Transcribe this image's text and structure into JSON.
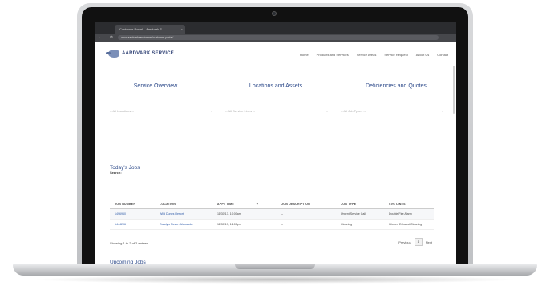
{
  "browser": {
    "tab_title": "Customer Portal – Aardvark S…",
    "tab_close": "×",
    "url": "www.aardvarkservice.net/customer-portal/",
    "nav_back": "←",
    "nav_forward": "→",
    "nav_reload": "⟳",
    "menu": "⋮"
  },
  "site": {
    "logo_text": "AARDVARK SERVICE",
    "nav": [
      "Home",
      "Products and Services",
      "Service Areas",
      "Service Request",
      "About Us",
      "Contact"
    ]
  },
  "tabs": [
    "Service Overview",
    "Locations and Assets",
    "Deficiencies and Quotes"
  ],
  "filters": [
    "-- All Locations --",
    "-- All Service Lines --",
    "-- All Job Types --"
  ],
  "todays_jobs": {
    "title": "Today's Jobs",
    "search_label": "Search:",
    "columns": [
      "JOB NUMBER",
      "LOCATION",
      "APPT TIME",
      "JOB DESCRIPTION",
      "JOB TYPE",
      "SVC LINES"
    ],
    "sort_indicator": "▼",
    "rows": [
      [
        "1496960",
        "Wild Dunes Resort",
        "11/30/17, 10:00am",
        "–",
        "Urgent Service Call",
        "Double Fire Alarm"
      ],
      [
        "1444206",
        "Randy's Pizza - Alexander",
        "11/30/17, 12:00pm",
        "–",
        "Cleaning",
        "Kitchen Exhaust Cleaning"
      ]
    ],
    "showing": "Showing 1 to 2 of 2 entries",
    "pager": {
      "previous": "Previous",
      "current": "1",
      "next": "Next"
    }
  },
  "upcoming_jobs": {
    "title": "Upcoming Jobs"
  }
}
